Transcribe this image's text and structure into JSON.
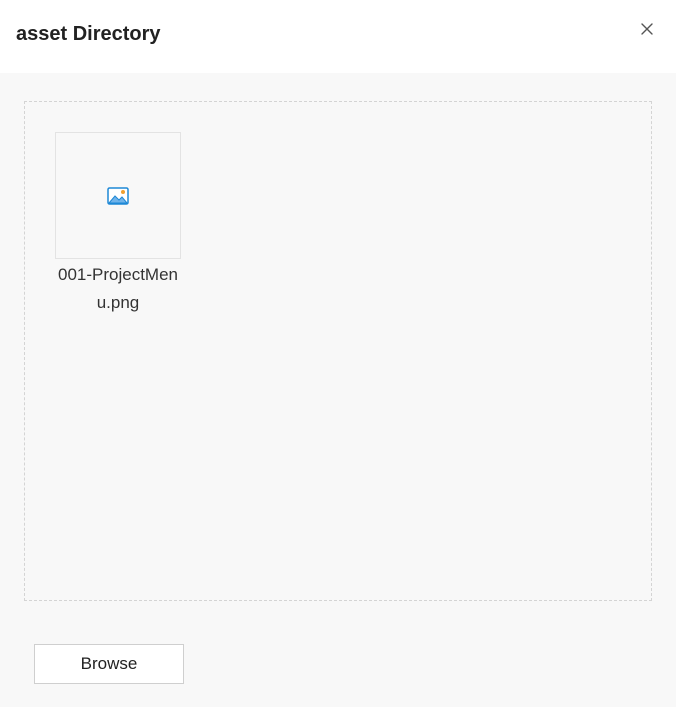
{
  "dialog": {
    "title": "asset Directory",
    "close_icon": "close-icon"
  },
  "files": [
    {
      "name": "001-ProjectMenu.png",
      "icon": "image-file-icon"
    }
  ],
  "actions": {
    "browse_label": "Browse"
  },
  "colors": {
    "background": "#f8f8f8",
    "header": "#ffffff",
    "icon_blue": "#1e88d6",
    "icon_orange": "#f0a030"
  }
}
